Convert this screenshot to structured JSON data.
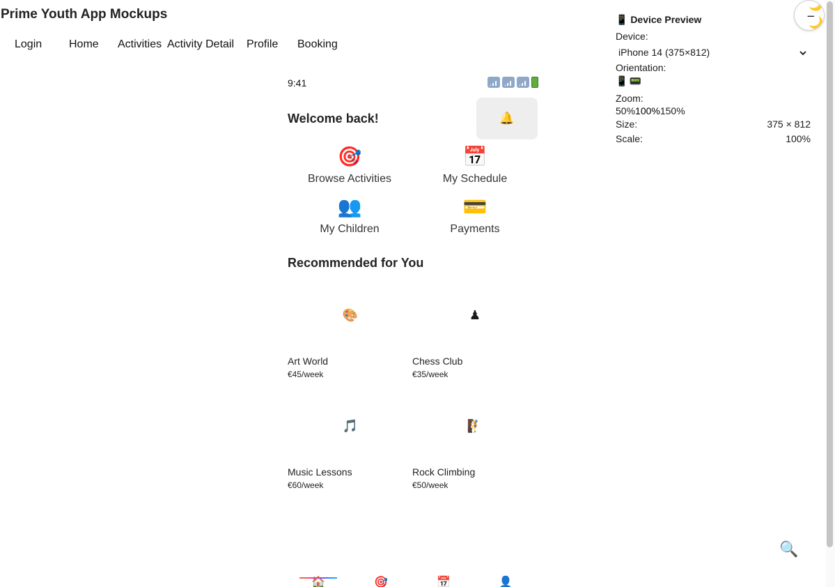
{
  "app": {
    "title": "Prime Youth App Mockups"
  },
  "nav": {
    "items": [
      {
        "label": "Login"
      },
      {
        "label": "Home"
      },
      {
        "label": "Activities"
      },
      {
        "label": "Activity Detail"
      },
      {
        "label": "Profile"
      },
      {
        "label": "Booking"
      }
    ]
  },
  "phone": {
    "status": {
      "time": "9:41"
    },
    "header": {
      "welcome": "Welcome back!",
      "bell_icon": "🔔"
    },
    "quick_actions": [
      {
        "icon": "🎯",
        "label": "Browse Activities"
      },
      {
        "icon": "📅",
        "label": "My Schedule"
      },
      {
        "icon": "👥",
        "label": "My Children"
      },
      {
        "icon": "💳",
        "label": "Payments"
      }
    ],
    "recommended": {
      "title": "Recommended for You",
      "items": [
        {
          "icon": "🎨",
          "name": "Art World",
          "price": "€45/week"
        },
        {
          "icon": "♟",
          "name": "Chess Club",
          "price": "€35/week"
        },
        {
          "icon": "🎵",
          "name": "Music Lessons",
          "price": "€60/week"
        },
        {
          "icon": "🧗",
          "name": "Rock Climbing",
          "price": "€50/week"
        }
      ]
    },
    "bottom_nav": [
      {
        "icon": "🏠",
        "active": true
      },
      {
        "icon": "🎯",
        "active": false
      },
      {
        "icon": "📅",
        "active": false
      },
      {
        "icon": "👤",
        "active": false
      }
    ]
  },
  "search_fab": {
    "icon": "🔍"
  },
  "device_preview": {
    "title": "📱 Device Preview",
    "device_label": "Device:",
    "device_value": "iPhone 14 (375×812)",
    "orientation_label": "Orientation:",
    "orientation_portrait_icon": "📱",
    "orientation_landscape_icon": "📟",
    "zoom_label": "Zoom:",
    "zoom_options": [
      "50%",
      "100%",
      "150%"
    ],
    "size_label": "Size:",
    "size_value": "375 × 812",
    "scale_label": "Scale:",
    "scale_value": "100%"
  },
  "theme_toggle": {
    "icon": "🌙",
    "dash": "−"
  },
  "colors": {
    "accent_gradient": [
      "#ff6b35",
      "#ff3d8f",
      "#6a5cff",
      "#00bfff"
    ],
    "bell_bg": "#eeeeee",
    "moon": "#f2c230"
  }
}
